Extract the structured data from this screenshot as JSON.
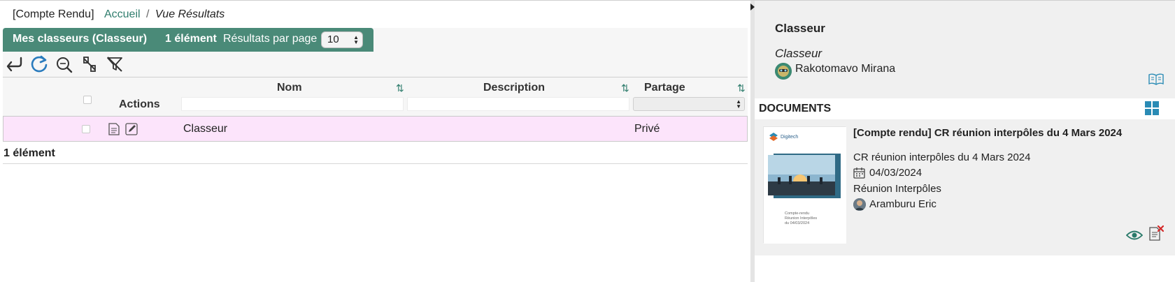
{
  "breadcrumb": {
    "prefix": "[Compte Rendu]",
    "home": "Accueil",
    "separator": "/",
    "current": "Vue Résultats"
  },
  "list": {
    "tab_title": "Mes classeurs (Classeur)",
    "count_label": "1 élément",
    "per_page_label": "Résultats par page",
    "per_page_value": "10",
    "toolbar_icons": [
      "back-arrow-icon",
      "refresh-icon",
      "search-reset-icon",
      "no-link-icon",
      "clear-filter-icon"
    ],
    "columns": {
      "actions": "Actions",
      "name": "Nom",
      "description": "Description",
      "sharing": "Partage"
    },
    "rows": [
      {
        "name": "Classeur",
        "description": "",
        "sharing": "Privé"
      }
    ],
    "footer_count": "1 élément"
  },
  "details": {
    "title": "Classeur",
    "subtitle": "Classeur",
    "owner": "Rakotomavo Mirana"
  },
  "documents": {
    "section_label": "DOCUMENTS",
    "items": [
      {
        "title": "[Compte rendu] CR réunion interpôles du 4 Mars 2024",
        "subtitle": "CR réunion interpôles du 4 Mars 2024",
        "date": "04/03/2024",
        "category": "Réunion Interpôles",
        "author": "Aramburu Eric",
        "thumb_brand": "Digitech",
        "thumb_caption": [
          "Compte-rendu",
          "Réunion Interpôles",
          "du 04/03/2024"
        ]
      }
    ]
  },
  "colors": {
    "accent": "#4a8a78",
    "link": "#2f7d6d",
    "selected_row": "#fce4fb",
    "panel_bg": "#f0f0f0"
  }
}
